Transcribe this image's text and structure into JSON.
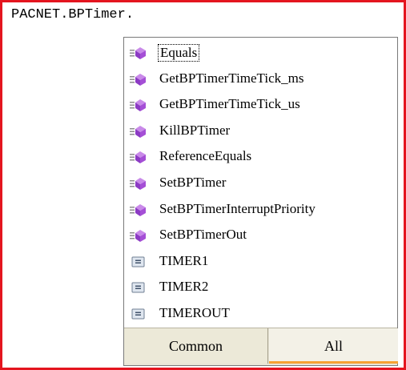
{
  "editor": {
    "code_text": "PACNET.BPTimer."
  },
  "intellisense": {
    "items": [
      {
        "label": "Equals",
        "icon": "method-icon"
      },
      {
        "label": "GetBPTimerTimeTick_ms",
        "icon": "method-icon"
      },
      {
        "label": "GetBPTimerTimeTick_us",
        "icon": "method-icon"
      },
      {
        "label": "KillBPTimer",
        "icon": "method-icon"
      },
      {
        "label": "ReferenceEquals",
        "icon": "method-icon"
      },
      {
        "label": "SetBPTimer",
        "icon": "method-icon"
      },
      {
        "label": "SetBPTimerInterruptPriority",
        "icon": "method-icon"
      },
      {
        "label": "SetBPTimerOut",
        "icon": "method-icon"
      },
      {
        "label": "TIMER1",
        "icon": "enum-icon"
      },
      {
        "label": "TIMER2",
        "icon": "enum-icon"
      },
      {
        "label": "TIMEROUT",
        "icon": "enum-icon"
      }
    ],
    "tabs": {
      "common": "Common",
      "all": "All"
    }
  },
  "colors": {
    "frame": "#e4151f",
    "method_purple": "#a54fd6",
    "tab_accent": "#f7a233"
  }
}
